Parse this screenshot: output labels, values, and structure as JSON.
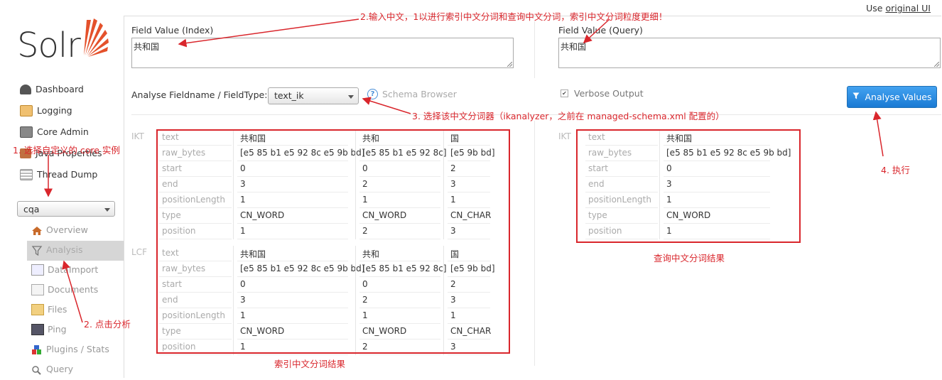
{
  "header": {
    "use_text": "Use",
    "original_ui_link": "original UI"
  },
  "logo": {
    "text": "Solr"
  },
  "sidebar": {
    "items": [
      {
        "label": "Dashboard",
        "icon": "dashboard-icon"
      },
      {
        "label": "Logging",
        "icon": "logging-icon"
      },
      {
        "label": "Core Admin",
        "icon": "core-admin-icon"
      },
      {
        "label": "Java Properties",
        "icon": "java-icon"
      },
      {
        "label": "Thread Dump",
        "icon": "thread-dump-icon"
      }
    ],
    "core_selector": {
      "value": "cqa"
    },
    "core_items": [
      {
        "label": "Overview",
        "icon": "home-icon"
      },
      {
        "label": "Analysis",
        "icon": "filter-icon",
        "active": true
      },
      {
        "label": "DataImport",
        "icon": "dataimport-icon"
      },
      {
        "label": "Documents",
        "icon": "documents-icon"
      },
      {
        "label": "Files",
        "icon": "files-icon"
      },
      {
        "label": "Ping",
        "icon": "ping-icon"
      },
      {
        "label": "Plugins / Stats",
        "icon": "plugins-icon"
      },
      {
        "label": "Query",
        "icon": "query-icon"
      }
    ]
  },
  "main": {
    "index_label": "Field Value (Index)",
    "index_value": "共和国",
    "query_label": "Field Value (Query)",
    "query_value": "共和国",
    "fieldtype_label": "Analyse Fieldname / FieldType:",
    "fieldtype_value": "text_ik",
    "schema_browser": "Schema Browser",
    "verbose_label": "Verbose Output",
    "verbose_checked": true,
    "analyse_button": "Analyse Values"
  },
  "index_analysis": {
    "row_labels": [
      "text",
      "raw_bytes",
      "start",
      "end",
      "positionLength",
      "type",
      "position"
    ],
    "stages": [
      {
        "name": "IKT",
        "tokens": [
          [
            "共和国",
            "[e5 85 b1 e5 92 8c e5 9b bd]",
            "0",
            "3",
            "1",
            "CN_WORD",
            "1"
          ],
          [
            "共和",
            "[e5 85 b1 e5 92 8c]",
            "0",
            "2",
            "1",
            "CN_WORD",
            "2"
          ],
          [
            "国",
            "[e5 9b bd]",
            "2",
            "3",
            "1",
            "CN_CHAR",
            "3"
          ]
        ]
      },
      {
        "name": "LCF",
        "tokens": [
          [
            "共和国",
            "[e5 85 b1 e5 92 8c e5 9b bd]",
            "0",
            "3",
            "1",
            "CN_WORD",
            "1"
          ],
          [
            "共和",
            "[e5 85 b1 e5 92 8c]",
            "0",
            "2",
            "1",
            "CN_WORD",
            "2"
          ],
          [
            "国",
            "[e5 9b bd]",
            "2",
            "3",
            "1",
            "CN_CHAR",
            "3"
          ]
        ]
      }
    ]
  },
  "query_analysis": {
    "row_labels": [
      "text",
      "raw_bytes",
      "start",
      "end",
      "positionLength",
      "type",
      "position"
    ],
    "stages": [
      {
        "name": "IKT",
        "tokens": [
          [
            "共和国",
            "[e5 85 b1 e5 92 8c e5 9b bd]",
            "0",
            "3",
            "1",
            "CN_WORD",
            "1"
          ]
        ]
      }
    ]
  },
  "annotations": {
    "a1": "1. 选择自定义的 core 实例",
    "a2": "2.输入中文，1以进行索引中文分词和查询中文分词，索引中文分词粒度更细！",
    "a2b": "2. 点击分析",
    "a3": "3. 选择该中文分词器（ikanalyzer，之前在 managed-schema.xml 配置的）",
    "a4": "4. 执行",
    "index_result": "索引中文分词结果",
    "query_result": "查询中文分词结果"
  },
  "colors": {
    "accent": "#d9262c",
    "button": "#1a7ad4",
    "logo_sun": "#e4512b"
  }
}
